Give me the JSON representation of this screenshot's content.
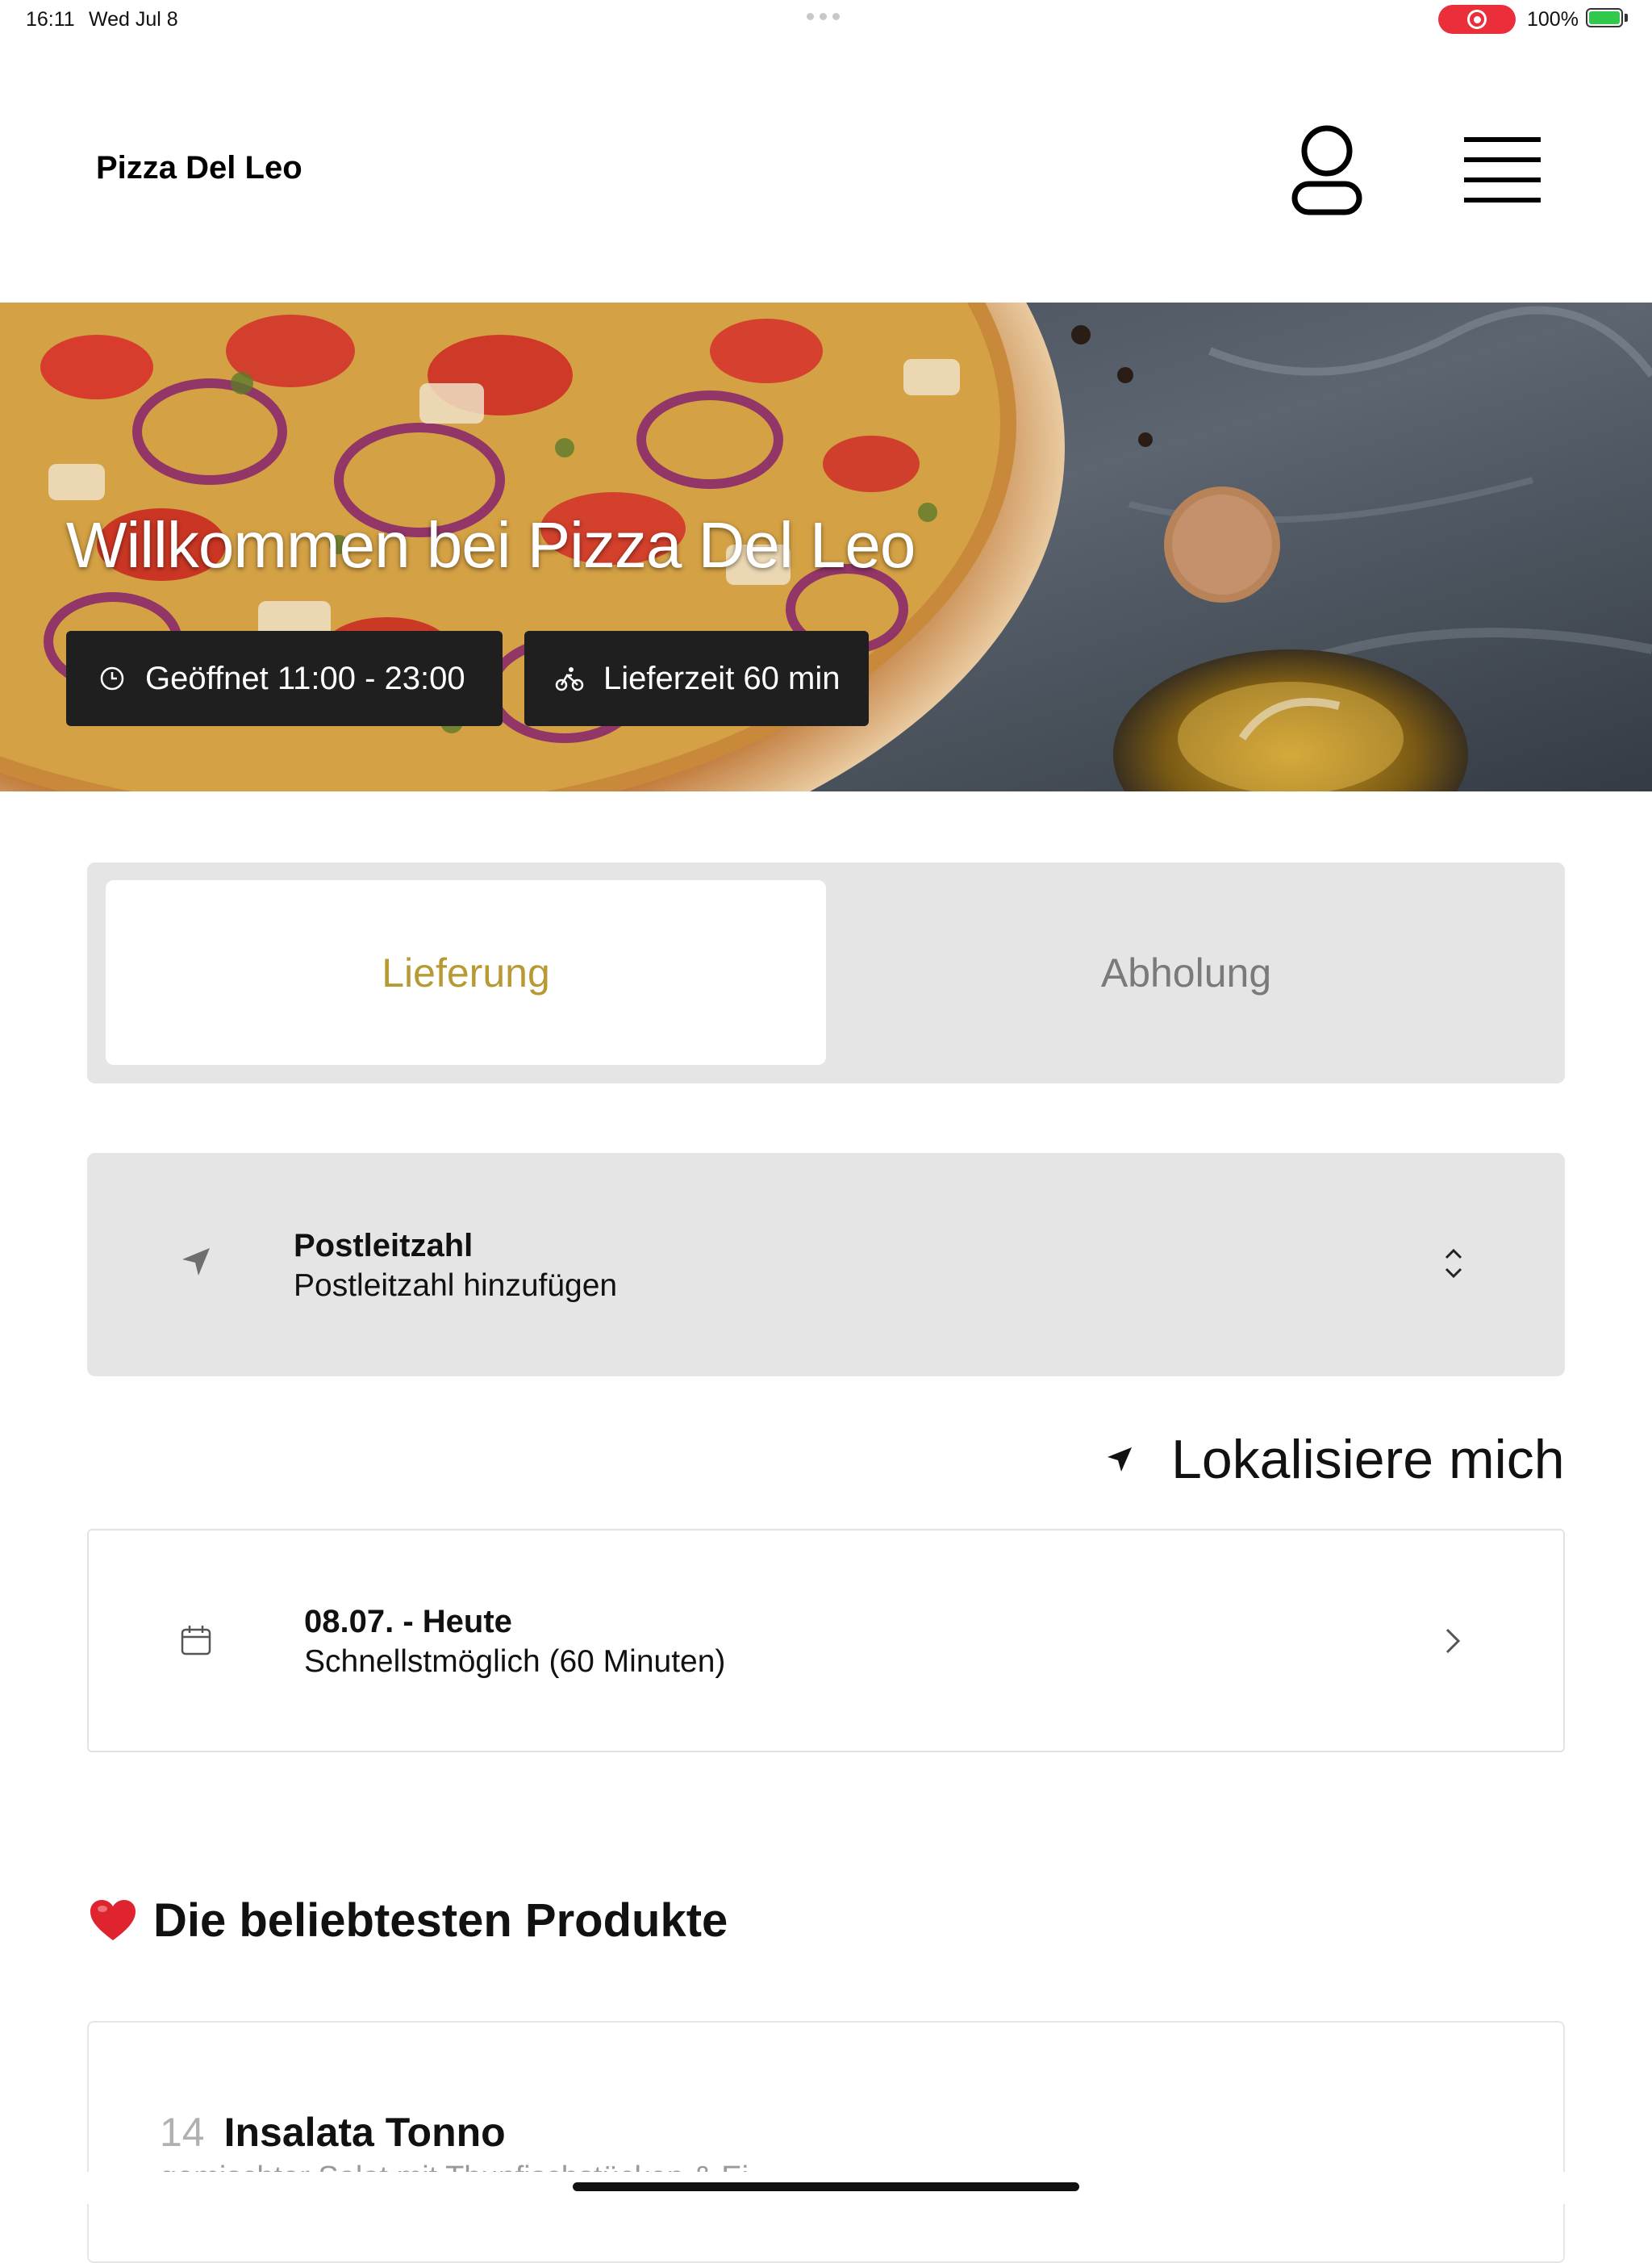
{
  "status_bar": {
    "time": "16:11",
    "date": "Wed Jul 8",
    "battery": "100%",
    "recording_color": "#ea2f3b"
  },
  "header": {
    "brand": "Pizza Del Leo",
    "icons": [
      "user-icon",
      "hamburger-menu-icon"
    ]
  },
  "hero": {
    "title": "Willkommen bei Pizza Del Leo",
    "opening_hours": "Geöffnet 11:00 - 23:00",
    "delivery_time": "Lieferzeit 60 min",
    "icons": [
      "clock-icon",
      "bicycle-icon"
    ]
  },
  "order_type": {
    "tabs": [
      "Lieferung",
      "Abholung"
    ],
    "selected": "Lieferung",
    "accent_color": "#b89a35"
  },
  "postal_code": {
    "label": "Postleitzahl",
    "value": "Postleitzahl hinzufügen"
  },
  "locate": {
    "label": "Lokalisiere mich"
  },
  "delivery_slot": {
    "date": "08.07. - Heute",
    "time": "Schnellstmöglich (60 Minuten)"
  },
  "popular": {
    "title": "Die beliebtesten Produkte",
    "products": [
      {
        "number": "14",
        "name": "Insalata Tonno",
        "description": "gemischter Salat mit Thunfischstücken & Ei"
      }
    ]
  }
}
